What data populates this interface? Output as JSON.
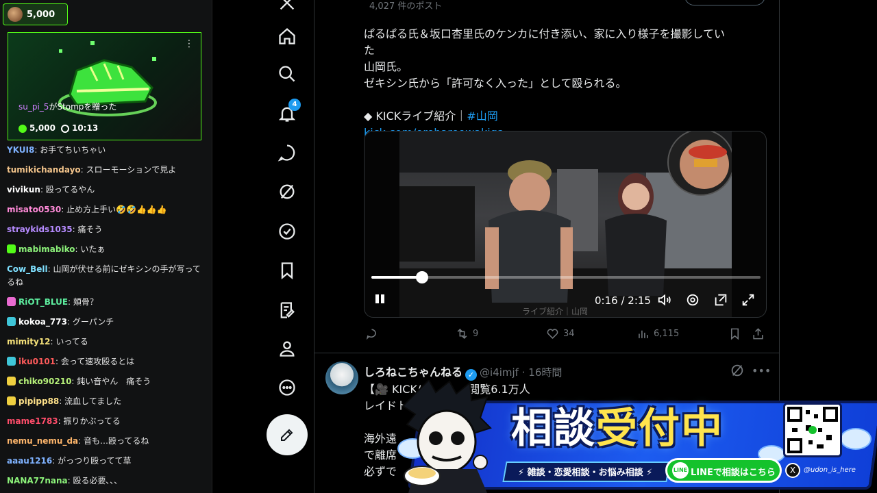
{
  "chat": {
    "top_points": "5,000",
    "gift": {
      "username": "su_pi_5",
      "message": "がStompを贈った",
      "points": "5,000",
      "duration": "10:13"
    },
    "messages": [
      {
        "user": "YKUI8",
        "color": "#7fb2ff",
        "text": "お手てちいちゃい",
        "badge": ""
      },
      {
        "user": "tumikichandayo",
        "color": "#f3c48b",
        "text": "スローモーションで見よ",
        "badge": ""
      },
      {
        "user": "vivikun",
        "color": "#ffffff",
        "text": "殴ってるやん",
        "badge": ""
      },
      {
        "user": "misato0530",
        "color": "#ff8ad8",
        "text": "止め方上手い🤣🤣👍👍👍",
        "badge": ""
      },
      {
        "user": "straykids1035",
        "color": "#b68bff",
        "text": "痛そう",
        "badge": ""
      },
      {
        "user": "mabimabiko",
        "color": "#8cf27a",
        "text": "いたぁ",
        "badge": "#53fc18"
      },
      {
        "user": "Cow_Bell",
        "color": "#7fe0ff",
        "text": "山岡が伏せる前にゼキシンの手が写ってるね",
        "badge": ""
      },
      {
        "user": "RiOT_BLUE",
        "color": "#5ef0a0",
        "text": "頬骨？",
        "badge": "#e96bd0"
      },
      {
        "user": "kokoa_773",
        "color": "#ffffff",
        "text": "グーパンチ",
        "badge": "#3fc6d8"
      },
      {
        "user": "mimity12",
        "color": "#f6e27a",
        "text": "いってる",
        "badge": ""
      },
      {
        "user": "iku0101",
        "color": "#ff5b5b",
        "text": "会って速攻殴るとは",
        "badge": "#3fc6d8"
      },
      {
        "user": "chiko90210",
        "color": "#b7f27a",
        "text": "鈍い音やん　痛そう",
        "badge": "#f0d040"
      },
      {
        "user": "pipipp88",
        "color": "#ffe28a",
        "text": "流血してました",
        "badge": "#f0d040"
      },
      {
        "user": "mame1783",
        "color": "#ff4d6a",
        "text": "振りかぶってる",
        "badge": ""
      },
      {
        "user": "nemu_nemu_da",
        "color": "#ffb66b",
        "text": "音も…殴ってるね",
        "badge": ""
      },
      {
        "user": "aaau1216",
        "color": "#7fb2ff",
        "text": "がっつり殴ってて草",
        "badge": ""
      },
      {
        "user": "NANA77nana",
        "color": "#8cf27a",
        "text": "殴る必要､､､",
        "badge": ""
      }
    ]
  },
  "nav": {
    "notifications_count": "4",
    "items": [
      "home",
      "explore",
      "notifications",
      "messages",
      "grok",
      "communities",
      "bookmarks",
      "lists",
      "profile",
      "more"
    ]
  },
  "feed": {
    "post_count": "4,027 件のポスト",
    "tweet1": {
      "line1": "ぱるぱる氏＆坂口杏里氏のケンカに付き添い、家に入り様子を撮影していた",
      "line2": "山岡氏。",
      "line3": "ゼキシン氏から「許可なく入った」として殴られる。",
      "line4_prefix": "◆ KICKライブ紹介｜",
      "line4_hashtag": "#山岡",
      "link": "kick.com/orehareowakiga",
      "video": {
        "time": "0:16 / 2:15",
        "progress": 0.13,
        "watermark": "ライブ紹介｜山岡"
      },
      "stats": {
        "reposts": "9",
        "likes": "34",
        "views": "6,115"
      }
    },
    "tweet2": {
      "name": "しろねこちゃんねる",
      "handle": "@i4imjf",
      "time": "· 16時間",
      "line1": "【🎥 KICK/",
      "line1_end": "閲覧6.1万人",
      "line2": "レイドト",
      "line3": "海外遠",
      "line4": "で離席",
      "line5": "必ずで"
    }
  },
  "banner": {
    "title_a": "相談",
    "title_b": "受付中",
    "subtitle": "雑談・恋愛相談・お悩み相談",
    "line_label": "LINE",
    "line_text": "LINEで相談はこちら",
    "x_label": "X",
    "handle": "@udon_is_here"
  }
}
